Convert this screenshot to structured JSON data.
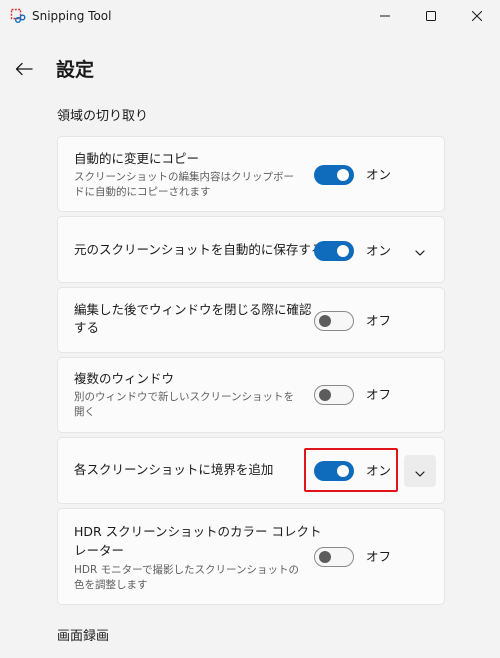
{
  "window": {
    "title": "Snipping Tool",
    "icon": "snipping-tool-icon",
    "controls": [
      "minimize-icon",
      "maximize-icon",
      "close-icon"
    ]
  },
  "header": {
    "back_icon": "back-arrow-icon",
    "title": "設定"
  },
  "sections": {
    "snip_region": "領域の切り取り",
    "screen_recording": "画面録画"
  },
  "settings": [
    {
      "title": "自動的に変更にコピー",
      "description_line1": "スクリーンショットの編集内容はクリップボー",
      "description_line2": "ドに自動的にコピーされます",
      "state": "オン",
      "on": true
    },
    {
      "title": "元のスクリーンショットを自動的に保存する",
      "state": "オン",
      "on": true,
      "expandable": true
    },
    {
      "title": "編集した後でウィンドウを閉じる際に確認",
      "title_line2": "する",
      "state": "オフ",
      "on": false
    },
    {
      "title": "複数のウィンドウ",
      "description_line1": "別のウィンドウで新しいスクリーンショットを",
      "description_line2": "開く",
      "state": "オフ",
      "on": false
    },
    {
      "title": "各スクリーンショットに境界を追加",
      "state": "オン",
      "on": true,
      "expandable": true
    },
    {
      "title": "HDR スクリーンショットのカラー コレクト",
      "title_line2": "レーター",
      "description_line1": "HDR モニターで撮影したスクリーンショットの",
      "description_line2": "色を調整します",
      "state": "オフ",
      "on": false
    }
  ],
  "colors": {
    "accent": "#0f6cbd",
    "highlight": "#e3131b",
    "background": "#f3f3f3",
    "card": "#fbfbfb"
  }
}
